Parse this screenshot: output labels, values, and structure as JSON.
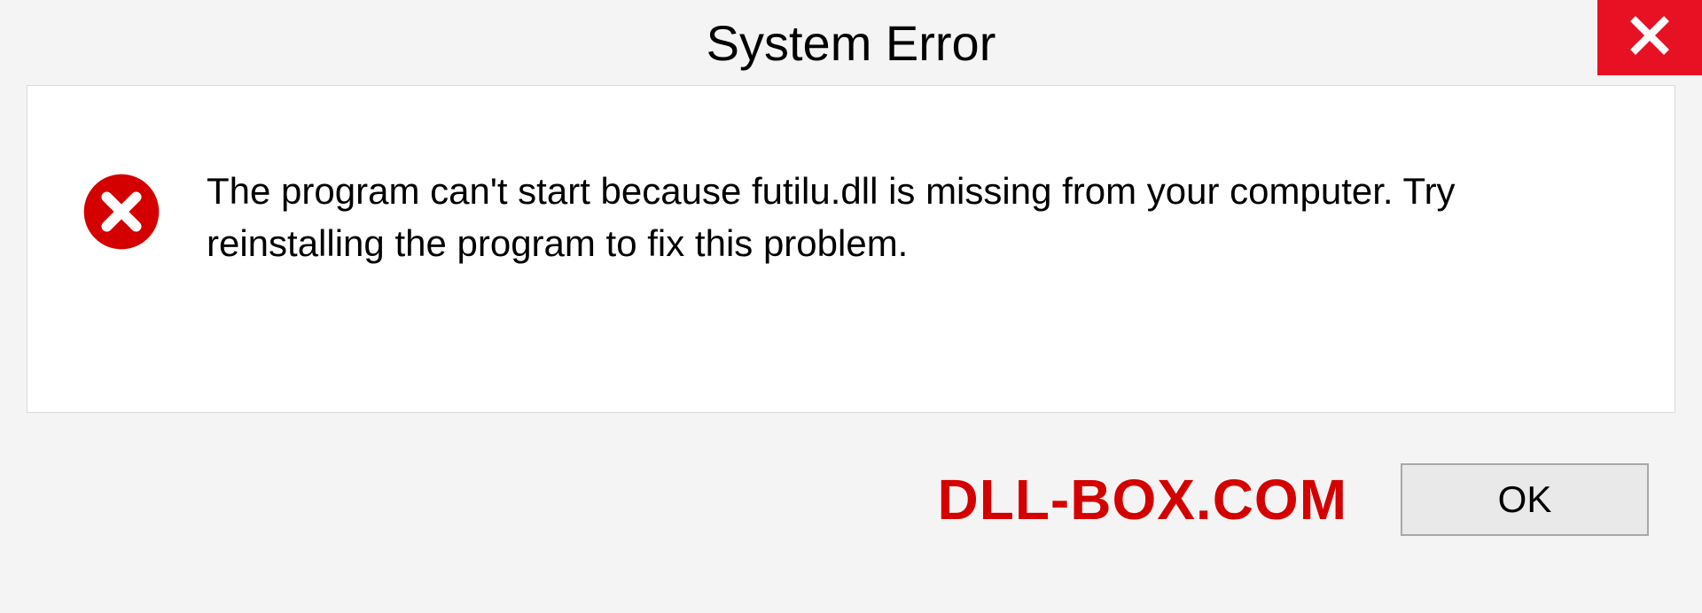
{
  "dialog": {
    "title": "System Error",
    "message": "The program can't start because futilu.dll is missing from your computer. Try reinstalling the program to fix this problem.",
    "ok_label": "OK"
  },
  "watermark": "DLL-BOX.COM",
  "colors": {
    "close_bg": "#e81123",
    "error_icon": "#d40000",
    "watermark": "#d40000"
  }
}
